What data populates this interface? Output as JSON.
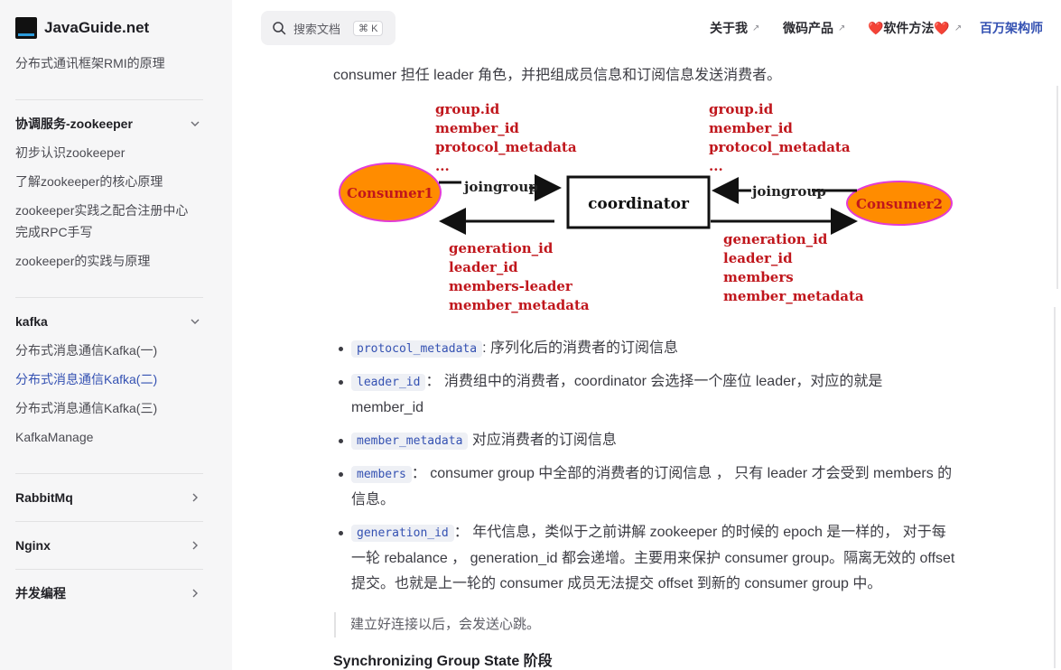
{
  "brand": {
    "name": "JavaGuide.net"
  },
  "sidebar": {
    "top_link": "分布式通讯框架RMI的原理",
    "groups": [
      {
        "title": "协调服务-zookeeper",
        "items": [
          "初步认识zookeeper",
          "了解zookeeper的核心原理",
          "zookeeper实践之配合注册中心完成RPC手写",
          "zookeeper的实践与原理"
        ]
      },
      {
        "title": "kafka",
        "items": [
          "分布式消息通信Kafka(一)",
          "分布式消息通信Kafka(二)",
          "分布式消息通信Kafka(三)",
          "KafkaManage"
        ]
      },
      {
        "title": "RabbitMq"
      },
      {
        "title": "Nginx"
      },
      {
        "title": "并发编程"
      }
    ]
  },
  "header": {
    "search_placeholder": "搜索文档",
    "search_shortcut": "⌘ K",
    "nav": [
      "关于我",
      "微码产品",
      "❤️软件方法❤️",
      "百万架构师"
    ],
    "nav_arrow": "↗"
  },
  "content": {
    "intro": "consumer 担任 leader 角色，并把组成员信息和订阅信息发送消费者。",
    "diagram": {
      "consumer1": "Consumer1",
      "consumer2": "Consumer2",
      "coordinator": "coordinator",
      "join_left": "joingroup",
      "join_right": "joingroup",
      "req_left": [
        "group.id",
        "member_id",
        "protocol_metadata",
        "..."
      ],
      "req_right": [
        "group.id",
        "member_id",
        "protocol_metadata",
        "..."
      ],
      "resp_left": [
        "generation_id",
        "leader_id",
        "members-leader",
        "member_metadata"
      ],
      "resp_right": [
        "generation_id",
        "leader_id",
        "members",
        "member_metadata"
      ],
      "colors": {
        "label": "#c0161c",
        "ellipse_fill": "#ff8c00",
        "ellipse_stroke": "#e23bd6",
        "arrow": "#111111"
      }
    },
    "bullets": [
      {
        "code": "protocol_metadata",
        "text": ": 序列化后的消费者的订阅信息"
      },
      {
        "code": "leader_id",
        "text": "： 消费组中的消费者，coordinator 会选择一个座位 leader，对应的就是 member_id"
      },
      {
        "code": "member_metadata",
        "text": " 对应消费者的订阅信息"
      },
      {
        "code": "members",
        "text": "： consumer group 中全部的消费者的订阅信息 ， 只有 leader 才会受到 members 的信息。"
      },
      {
        "code": "generation_id",
        "text": "： 年代信息，类似于之前讲解 zookeeper 的时候的 epoch 是一样的， 对于每一轮 rebalance ， generation_id 都会递增。主要用来保护 consumer group。隔离无效的 offset 提交。也就是上一轮的 consumer 成员无法提交 offset 到新的 consumer group 中。"
      }
    ],
    "quote": "建立好连接以后，会发送心跳。",
    "next_heading": "Synchronizing Group State 阶段"
  }
}
